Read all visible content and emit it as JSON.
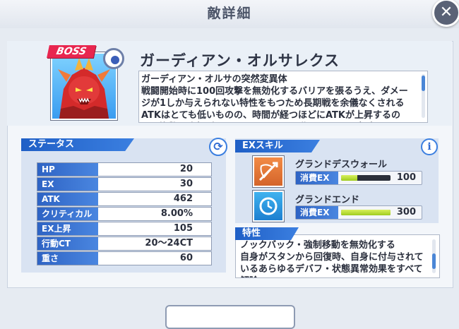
{
  "header": {
    "title": "敵詳細",
    "close_label": "✕"
  },
  "enemy": {
    "badge": "BOSS",
    "name": "ガーディアン・オルサレクス",
    "description": "ガーディアン・オルサの突然変異体\n戦闘開始時に100回攻撃を無効化するバリアを張るうえ、ダメージが1しか与えられない特性をもつため長期戦を余儀なくされるATKはとても低いものの、時間が経つほどにATKが上昇するので、複数回攻撃ができるEXスキルで早期にバリアの突破を目"
  },
  "status": {
    "title": "ステータス",
    "rows": [
      {
        "label": "HP",
        "value": "20"
      },
      {
        "label": "EX",
        "value": "30"
      },
      {
        "label": "ATK",
        "value": "462"
      },
      {
        "label": "クリティカル",
        "value": "8.00%"
      },
      {
        "label": "EX上昇",
        "value": "105"
      },
      {
        "label": "行動CT",
        "value": "20〜24CT"
      },
      {
        "label": "重さ",
        "value": "60"
      }
    ]
  },
  "ex_skill": {
    "title": "EXスキル",
    "info_label": "i",
    "skills": [
      {
        "name": "グランドデスウォール",
        "cost_label": "消費EX",
        "cost": "100",
        "fill_fraction": 0.33,
        "icon": "sword-shield-icon",
        "color": "#e4733a"
      },
      {
        "name": "グランドエンド",
        "cost_label": "消費EX",
        "cost": "300",
        "fill_fraction": 1.0,
        "icon": "clock-icon",
        "color": "#2a97e0"
      }
    ]
  },
  "trait": {
    "title": "特性",
    "text": "ノックバック・強制移動を無効化する\n自身がスタンから回復時、自身に付与されているあらゆるデバフ・状態異常効果をすべて解除"
  },
  "colors": {
    "accent": "#2e63c4",
    "boss": "#e8264f",
    "bar_fill": "#b6dd2e"
  }
}
